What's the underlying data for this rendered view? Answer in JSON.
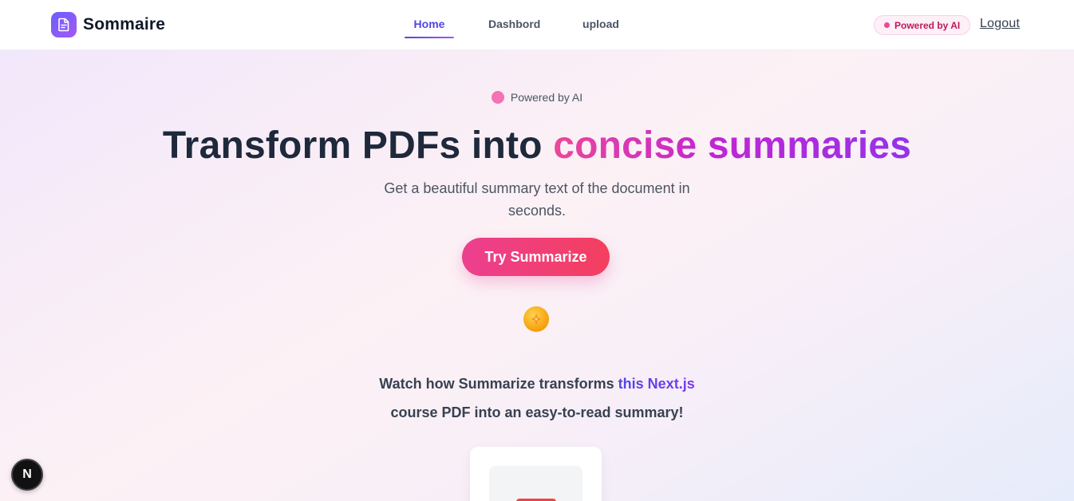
{
  "header": {
    "brand_name": "Sommaire",
    "nav": {
      "home": "Home",
      "dashboard": "Dashbord",
      "upload": "upload"
    },
    "pill": "Powered by AI",
    "logout": "Logout"
  },
  "hero": {
    "badge": "Powered by AI",
    "headline_plain": "Transform PDFs into ",
    "headline_accent": "concise summaries",
    "subtitle": "Get a beautiful summary text of the document in seconds.",
    "cta": "Try Summarize",
    "watch_line1_plain": "Watch how Summarize transforms ",
    "watch_line1_accent": "this Next.js",
    "watch_line2": "course PDF into an easy-to-read summary!"
  },
  "dev_badge": "N",
  "icons": {
    "brand": "document-icon",
    "spark": "sparkle-icon"
  },
  "colors": {
    "accent_indigo": "#4f46e5",
    "accent_pink": "#ec4899",
    "accent_purple": "#9333ea",
    "cta_from": "#ec3f8f",
    "cta_to": "#f43f5e"
  }
}
